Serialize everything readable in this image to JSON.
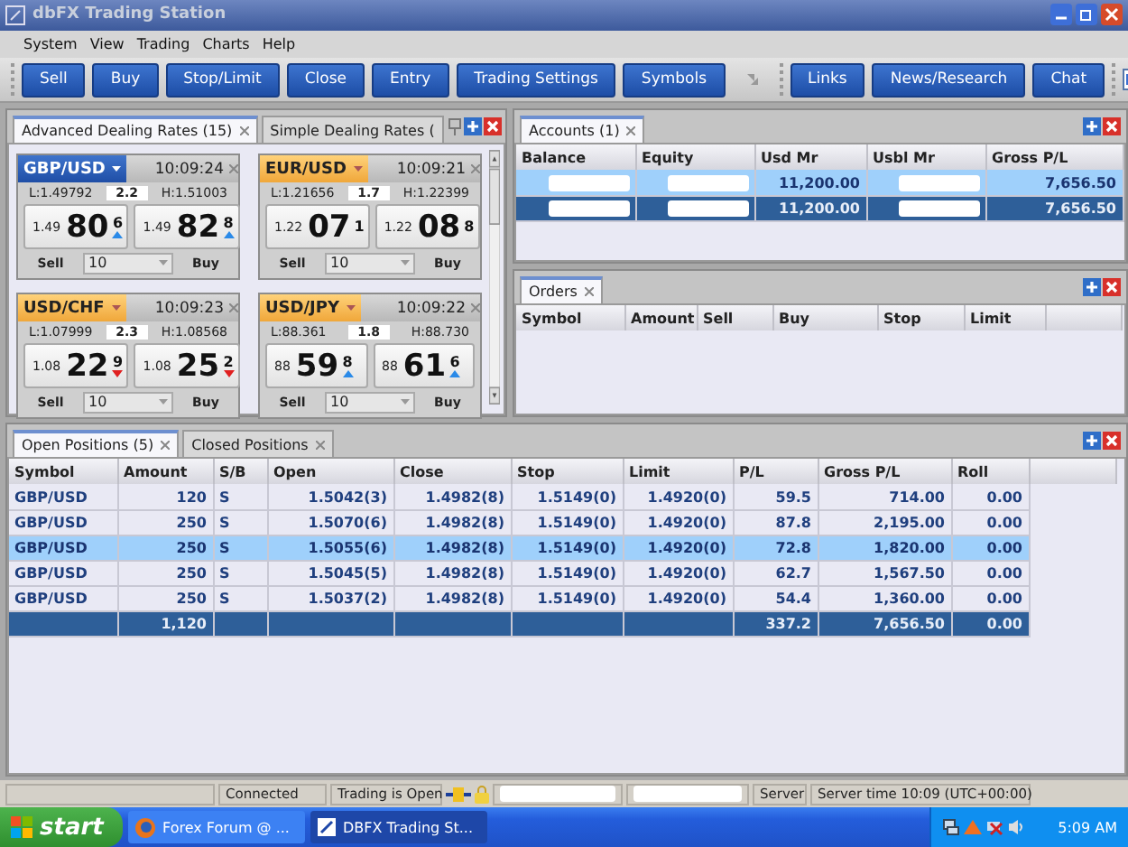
{
  "window": {
    "title": "dbFX Trading Station"
  },
  "menu": [
    "System",
    "View",
    "Trading",
    "Charts",
    "Help"
  ],
  "toolbar": {
    "trade_buttons": [
      "Sell",
      "Buy",
      "Stop/Limit",
      "Close",
      "Entry",
      "Trading Settings",
      "Symbols"
    ],
    "link_buttons": [
      "Links",
      "News/Research",
      "Chat"
    ]
  },
  "dealing_rates": {
    "tabs": [
      {
        "label": "Advanced Dealing Rates (15)",
        "selected": true,
        "closable": true
      },
      {
        "label": "Simple Dealing Rates (",
        "selected": false,
        "closable": false
      }
    ],
    "cards": [
      {
        "pair": "GBP/USD",
        "selected": true,
        "time": "10:09:24",
        "low": "L:1.49792",
        "spread": "2.2",
        "high": "H:1.51003",
        "quotes": [
          {
            "kind": "up",
            "prefix": "1.49",
            "big": "80",
            "pip": "6"
          },
          {
            "kind": "up",
            "prefix": "1.49",
            "big": "82",
            "pip": "8"
          }
        ],
        "sell_label": "Sell",
        "amount": "10",
        "buy_label": "Buy"
      },
      {
        "pair": "EUR/USD",
        "selected": false,
        "time": "10:09:21",
        "low": "L:1.21656",
        "spread": "1.7",
        "high": "H:1.22399",
        "quotes": [
          {
            "kind": "flat",
            "prefix": "1.22",
            "big": "07",
            "pip": "1"
          },
          {
            "kind": "flat",
            "prefix": "1.22",
            "big": "08",
            "pip": "8"
          }
        ],
        "sell_label": "Sell",
        "amount": "10",
        "buy_label": "Buy"
      },
      {
        "pair": "USD/CHF",
        "selected": false,
        "time": "10:09:23",
        "low": "L:1.07999",
        "spread": "2.3",
        "high": "H:1.08568",
        "quotes": [
          {
            "kind": "down",
            "prefix": "1.08",
            "big": "22",
            "pip": "9"
          },
          {
            "kind": "down",
            "prefix": "1.08",
            "big": "25",
            "pip": "2"
          }
        ],
        "sell_label": "Sell",
        "amount": "10",
        "buy_label": "Buy"
      },
      {
        "pair": "USD/JPY",
        "selected": false,
        "time": "10:09:22",
        "low": "L:88.361",
        "spread": "1.8",
        "high": "H:88.730",
        "quotes": [
          {
            "kind": "up",
            "prefix": "88",
            "big": "59",
            "pip": "8"
          },
          {
            "kind": "up",
            "prefix": "88",
            "big": "61",
            "pip": "6"
          }
        ],
        "sell_label": "Sell",
        "amount": "10",
        "buy_label": "Buy"
      }
    ]
  },
  "accounts": {
    "tabs": [
      {
        "label": "Accounts (1)",
        "selected": true,
        "closable": true
      }
    ],
    "columns": [
      "Balance",
      "Equity",
      "Usd Mr",
      "Usbl Mr",
      "Gross P/L"
    ],
    "rows": [
      {
        "kind": "row",
        "selected": true,
        "cells": [
          {
            "kind": "redacted"
          },
          {
            "kind": "redacted"
          },
          {
            "kind": "text",
            "text": "11,200.00"
          },
          {
            "kind": "redacted"
          },
          {
            "kind": "text",
            "text": "7,656.50"
          }
        ]
      },
      {
        "kind": "total",
        "selected": false,
        "cells": [
          {
            "kind": "redacted"
          },
          {
            "kind": "redacted"
          },
          {
            "kind": "text",
            "text": "11,200.00"
          },
          {
            "kind": "redacted"
          },
          {
            "kind": "text",
            "text": "7,656.50"
          }
        ]
      }
    ]
  },
  "orders": {
    "tabs": [
      {
        "label": "Orders",
        "selected": true,
        "closable": true
      }
    ],
    "columns": [
      "Symbol",
      "Amount",
      "Sell",
      "Buy",
      "Stop",
      "Limit"
    ]
  },
  "positions": {
    "tabs": [
      {
        "label": "Open Positions (5)",
        "selected": true,
        "closable": true
      },
      {
        "label": "Closed Positions",
        "selected": false,
        "closable": true
      }
    ],
    "columns": [
      "Symbol",
      "Amount",
      "S/B",
      "Open",
      "Close",
      "Stop",
      "Limit",
      "P/L",
      "Gross P/L",
      "Roll"
    ],
    "rows": [
      {
        "kind": "row",
        "selected": false,
        "cells": [
          "GBP/USD",
          "120",
          "S",
          "1.5042(3)",
          "1.4982(8)",
          "1.5149(0)",
          "1.4920(0)",
          "59.5",
          "714.00",
          "0.00"
        ]
      },
      {
        "kind": "row",
        "selected": false,
        "cells": [
          "GBP/USD",
          "250",
          "S",
          "1.5070(6)",
          "1.4982(8)",
          "1.5149(0)",
          "1.4920(0)",
          "87.8",
          "2,195.00",
          "0.00"
        ]
      },
      {
        "kind": "row",
        "selected": true,
        "cells": [
          "GBP/USD",
          "250",
          "S",
          "1.5055(6)",
          "1.4982(8)",
          "1.5149(0)",
          "1.4920(0)",
          "72.8",
          "1,820.00",
          "0.00"
        ]
      },
      {
        "kind": "row",
        "selected": false,
        "cells": [
          "GBP/USD",
          "250",
          "S",
          "1.5045(5)",
          "1.4982(8)",
          "1.5149(0)",
          "1.4920(0)",
          "62.7",
          "1,567.50",
          "0.00"
        ]
      },
      {
        "kind": "row",
        "selected": false,
        "cells": [
          "GBP/USD",
          "250",
          "S",
          "1.5037(2)",
          "1.4982(8)",
          "1.5149(0)",
          "1.4920(0)",
          "54.4",
          "1,360.00",
          "0.00"
        ]
      },
      {
        "kind": "total",
        "selected": false,
        "cells": [
          "",
          "1,120",
          "",
          "",
          "",
          "",
          "",
          "337.2",
          "7,656.50",
          "0.00"
        ]
      }
    ]
  },
  "status_bar": {
    "connection": "Connected",
    "trading": "Trading is Open",
    "server": "Server",
    "server_time": "Server time 10:09 (UTC+00:00)"
  },
  "taskbar": {
    "start": "start",
    "tasks": [
      {
        "label": "Forex Forum @ ...",
        "selected": false
      },
      {
        "label": "DBFX Trading St...",
        "selected": true
      }
    ],
    "clock": "5:09 AM"
  }
}
